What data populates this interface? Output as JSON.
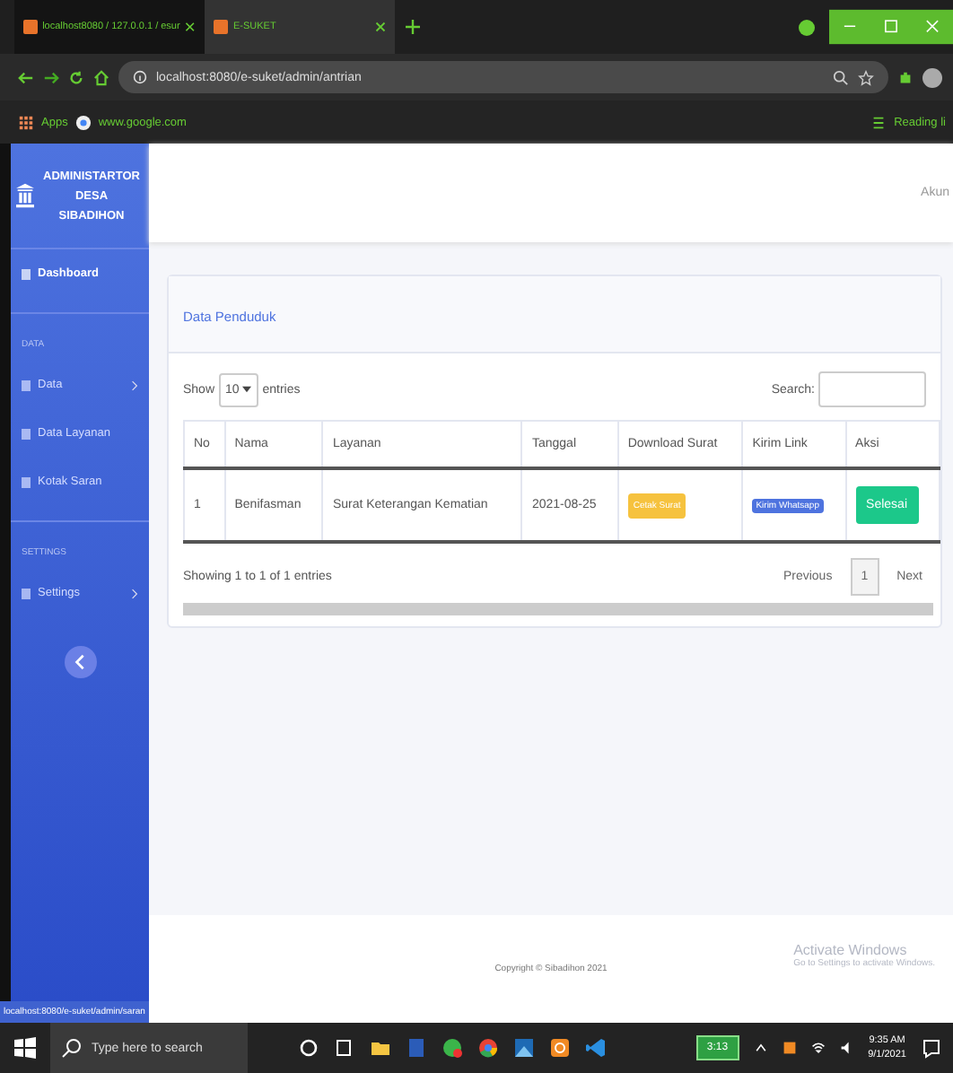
{
  "browser": {
    "tabs": [
      {
        "title": "localhost8080 / 127.0.0.1 / esur",
        "selected": false
      },
      {
        "title": "E-SUKET",
        "selected": true
      }
    ],
    "address": "localhost:8080/e-suket/admin/antrian",
    "bookmarks": [
      "Apps",
      "www.google.com"
    ],
    "reading_list": "Reading li",
    "status_url": "localhost:8080/e-suket/admin/saran"
  },
  "sidebar": {
    "brand": [
      "ADMINISTARTOR",
      "DESA",
      "SIBADIHON"
    ],
    "items": [
      {
        "kind": "link",
        "label": "Dashboard",
        "selected": true,
        "arrow": false
      },
      {
        "kind": "heading",
        "label": "DATA"
      },
      {
        "kind": "link",
        "label": "Data",
        "selected": false,
        "arrow": true
      },
      {
        "kind": "link",
        "label": "Data Layanan",
        "selected": false,
        "arrow": false
      },
      {
        "kind": "link",
        "label": "Kotak Saran",
        "selected": false,
        "arrow": false
      },
      {
        "kind": "heading",
        "label": "SETTINGS"
      },
      {
        "kind": "link",
        "label": "Settings",
        "selected": false,
        "arrow": true
      }
    ]
  },
  "topbar": {
    "user": "Akun"
  },
  "card": {
    "title": "Data Penduduk",
    "show_label": "Show",
    "page_size": "10",
    "entries_label": "entries",
    "search_label": "Search:",
    "table": {
      "columns": [
        "No",
        "Nama",
        "Layanan",
        "Tanggal",
        "Download Surat",
        "Kirim Link",
        "Aksi"
      ],
      "rows": [
        {
          "no": "1",
          "nama": "Benifasman",
          "layanan": "Surat Keterangan Kematian",
          "tanggal": "2021-08-25",
          "download": "Cetak Surat",
          "kirim": "Kirim Whatsapp",
          "aksi": "Selesai"
        }
      ]
    },
    "info": "Showing 1 to 1 of 1 entries",
    "pagination": [
      {
        "label": "Previous",
        "selected": false
      },
      {
        "label": "1",
        "selected": true
      },
      {
        "label": "Next",
        "selected": false
      }
    ]
  },
  "footer": "Copyright © Sibadihon 2021",
  "activation": {
    "title": "Activate Windows",
    "hint": "Go to Settings to activate Windows."
  },
  "taskbar": {
    "search_placeholder": "Type here to search",
    "battery": "3:13",
    "time": "9:35 AM",
    "date": "9/1/2021"
  }
}
